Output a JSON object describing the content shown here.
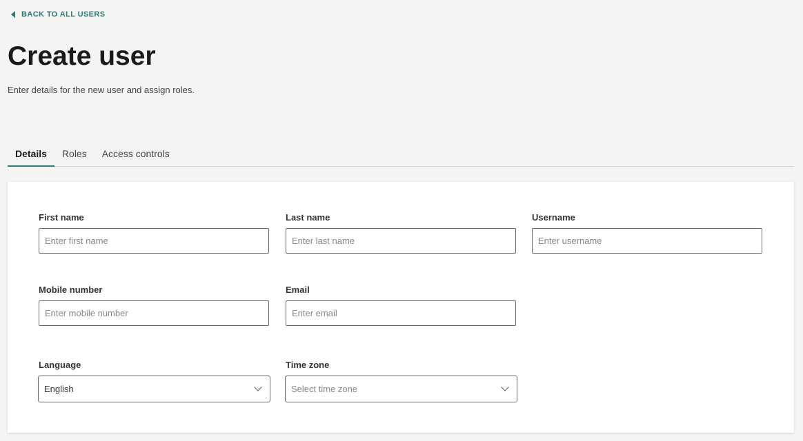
{
  "back_link": {
    "label": "BACK TO ALL USERS",
    "icon": "caret-left-icon"
  },
  "page": {
    "title": "Create user",
    "subtitle": "Enter details for the new user and assign roles."
  },
  "tabs": [
    {
      "label": "Details",
      "active": true
    },
    {
      "label": "Roles"
    },
    {
      "label": "Access controls"
    }
  ],
  "form": {
    "first_name": {
      "label": "First name",
      "placeholder": "Enter first name"
    },
    "last_name": {
      "label": "Last name",
      "placeholder": "Enter last name"
    },
    "username": {
      "label": "Username",
      "placeholder": "Enter username"
    },
    "mobile": {
      "label": "Mobile number",
      "placeholder": "Enter mobile number"
    },
    "email": {
      "label": "Email",
      "placeholder": "Enter email"
    },
    "language": {
      "label": "Language",
      "value": "English"
    },
    "timezone": {
      "label": "Time zone",
      "placeholder": "Select time zone"
    }
  },
  "colors": {
    "accent": "#2b7a77",
    "background": "#f4f4f2"
  }
}
